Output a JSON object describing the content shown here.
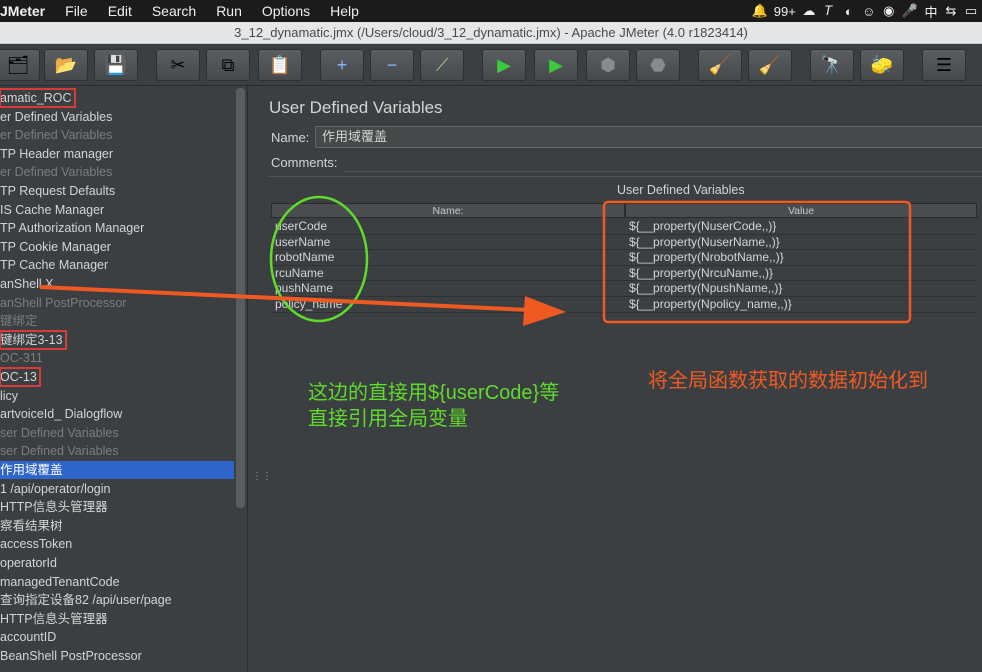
{
  "menubar": {
    "app": "JMeter",
    "items": [
      "File",
      "Edit",
      "Search",
      "Run",
      "Options",
      "Help"
    ],
    "notification_count": "99+",
    "input_method": "中"
  },
  "window": {
    "title": "3_12_dynamatic.jmx (/Users/cloud/3_12_dynamatic.jmx) - Apache JMeter (4.0 r1823414)"
  },
  "toolbar": {
    "buttons": [
      "templates-icon",
      "open-icon",
      "save-icon",
      "cut-icon",
      "copy-icon",
      "paste-icon",
      "expand-icon",
      "collapse-icon",
      "toggle-icon",
      "start-icon",
      "start-no-pauses-icon",
      "stop-icon",
      "shutdown-icon",
      "clear-icon",
      "clear-all-icon",
      "search-icon",
      "reset-search-icon",
      "function-helper-icon"
    ]
  },
  "tree": {
    "items": [
      {
        "label": "amatic_ROC",
        "state": "boxed"
      },
      {
        "label": "er Defined Variables",
        "state": "normal"
      },
      {
        "label": "er Defined Variables",
        "state": "disabled"
      },
      {
        "label": "TP Header manager",
        "state": "normal"
      },
      {
        "label": "er Defined Variables",
        "state": "disabled"
      },
      {
        "label": "TP Request Defaults",
        "state": "normal"
      },
      {
        "label": "IS Cache Manager",
        "state": "normal"
      },
      {
        "label": "TP Authorization Manager",
        "state": "normal"
      },
      {
        "label": "TP Cookie Manager",
        "state": "normal"
      },
      {
        "label": "TP Cache Manager",
        "state": "normal"
      },
      {
        "label": "anShell X",
        "state": "normal"
      },
      {
        "label": "anShell PostProcessor",
        "state": "disabled"
      },
      {
        "label": "键绑定",
        "state": "disabled"
      },
      {
        "label": "键绑定3-13",
        "state": "boxed"
      },
      {
        "label": "OC-311",
        "state": "disabled"
      },
      {
        "label": "OC-13",
        "state": "boxed"
      },
      {
        "label": "licy",
        "state": "normal"
      },
      {
        "label": "artvoiceId_ Dialogflow",
        "state": "normal"
      },
      {
        "label": "ser Defined Variables",
        "state": "disabled"
      },
      {
        "label": "ser Defined Variables",
        "state": "disabled"
      },
      {
        "label": "作用域覆盖",
        "state": "selected"
      },
      {
        "label": "1 /api/operator/login",
        "state": "normal"
      },
      {
        "label": "HTTP信息头管理器",
        "state": "normal"
      },
      {
        "label": "察看结果树",
        "state": "normal"
      },
      {
        "label": "accessToken",
        "state": "normal"
      },
      {
        "label": "operatorId",
        "state": "normal"
      },
      {
        "label": "managedTenantCode",
        "state": "normal"
      },
      {
        "label": "查询指定设备82 /api/user/page",
        "state": "normal"
      },
      {
        "label": "HTTP信息头管理器",
        "state": "normal"
      },
      {
        "label": "accountID",
        "state": "normal"
      },
      {
        "label": "BeanShell PostProcessor",
        "state": "normal"
      }
    ]
  },
  "panel": {
    "title": "User Defined Variables",
    "name_label": "Name:",
    "name_value": "作用域覆盖",
    "comments_label": "Comments:",
    "table_caption": "User Defined Variables",
    "columns": [
      "Name:",
      "Value"
    ],
    "rows": [
      {
        "name": "userCode",
        "value": "${__property(NuserCode,,)}"
      },
      {
        "name": "userName",
        "value": "${__property(NuserName,,)}"
      },
      {
        "name": "robotName",
        "value": "${__property(NrobotName,,)}"
      },
      {
        "name": "rcuName",
        "value": "${__property(NrcuName,,)}"
      },
      {
        "name": "pushName",
        "value": "${__property(NpushName,,)}"
      },
      {
        "name": "policy_name",
        "value": "${__property(Npolicy_name,,)}"
      }
    ]
  },
  "annotations": {
    "green_line1": "这边的直接用${userCode}等",
    "green_line2": "直接引用全局变量",
    "orange_text": "将全局函数获取的数据初始化到",
    "green_color": "#5fdb2b",
    "red_color": "#f05a22"
  }
}
